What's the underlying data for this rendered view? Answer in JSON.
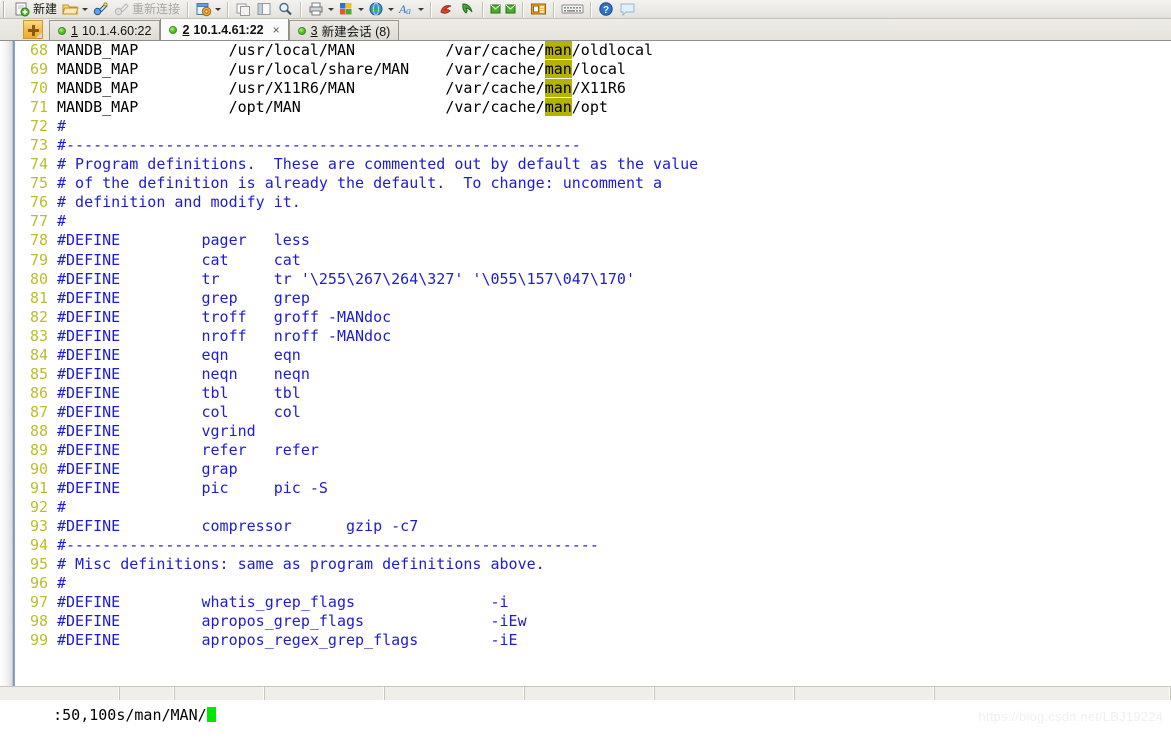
{
  "toolbar": {
    "new_label": "新建",
    "reconnect_label": "重新连接",
    "items": [
      {
        "name": "new-session-icon",
        "type": "icon"
      },
      {
        "name": "new-session-label",
        "type": "label"
      },
      {
        "name": "open-folder-icon",
        "type": "icon"
      },
      {
        "name": "open-folder-dropdown-arrow",
        "type": "arrow"
      },
      {
        "name": "connect-icon",
        "type": "icon"
      },
      {
        "name": "disconnect-icon",
        "type": "icon"
      },
      {
        "name": "reconnect-label",
        "type": "label-dim"
      },
      {
        "name": "session-options-icon",
        "type": "icon"
      },
      {
        "name": "session-options-dropdown-arrow",
        "type": "arrow"
      },
      {
        "name": "clone-session-icon",
        "type": "icon"
      },
      {
        "name": "tile-windows-icon",
        "type": "icon"
      },
      {
        "name": "find-icon",
        "type": "icon"
      },
      {
        "name": "print-icon",
        "type": "icon"
      },
      {
        "name": "print-dropdown-arrow",
        "type": "arrow"
      },
      {
        "name": "color-scheme-icon",
        "type": "icon"
      },
      {
        "name": "color-scheme-dropdown-arrow",
        "type": "arrow"
      },
      {
        "name": "globe-icon",
        "type": "icon"
      },
      {
        "name": "globe-dropdown-arrow",
        "type": "arrow"
      },
      {
        "name": "font-icon",
        "type": "icon"
      },
      {
        "name": "font-dropdown-arrow",
        "type": "arrow"
      },
      {
        "name": "upload-icon",
        "type": "icon"
      },
      {
        "name": "download-icon",
        "type": "icon"
      },
      {
        "name": "chat-green-icon",
        "type": "icon"
      },
      {
        "name": "chat-green2-icon",
        "type": "icon"
      },
      {
        "name": "window-log-icon",
        "type": "icon"
      },
      {
        "name": "keyboard-icon",
        "type": "icon"
      },
      {
        "name": "help-icon",
        "type": "icon"
      },
      {
        "name": "feedback-icon",
        "type": "icon"
      }
    ]
  },
  "tabs": {
    "new_tab_button": "+",
    "items": [
      {
        "num": "1",
        "title": "10.1.4.60:22",
        "active": false,
        "closable": false
      },
      {
        "num": "2",
        "title": "10.1.4.61:22",
        "active": true,
        "closable": true,
        "close_glyph": "×"
      },
      {
        "num": "3",
        "title": "新建会话 (8)",
        "active": false,
        "closable": false
      }
    ]
  },
  "terminal": {
    "lines": [
      {
        "num": "68",
        "segments": [
          {
            "text": "MANDB_MAP",
            "color": "black"
          },
          {
            "text": "          /usr/local/MAN",
            "color": "black"
          },
          {
            "text": "          /var/cache/",
            "color": "black"
          },
          {
            "text": "man",
            "color": "black",
            "highlight": true
          },
          {
            "text": "/oldlocal",
            "color": "black"
          }
        ]
      },
      {
        "num": "69",
        "segments": [
          {
            "text": "MANDB_MAP",
            "color": "black"
          },
          {
            "text": "          /usr/local/share/MAN",
            "color": "black"
          },
          {
            "text": "    /var/cache/",
            "color": "black"
          },
          {
            "text": "man",
            "color": "black",
            "highlight": true
          },
          {
            "text": "/local",
            "color": "black"
          }
        ]
      },
      {
        "num": "70",
        "segments": [
          {
            "text": "MANDB_MAP",
            "color": "black"
          },
          {
            "text": "          /usr/X11R6/MAN",
            "color": "black"
          },
          {
            "text": "          /var/cache/",
            "color": "black"
          },
          {
            "text": "man",
            "color": "black",
            "highlight": true
          },
          {
            "text": "/X11R6",
            "color": "black"
          }
        ]
      },
      {
        "num": "71",
        "segments": [
          {
            "text": "MANDB_MAP",
            "color": "black"
          },
          {
            "text": "          /opt/MAN",
            "color": "black"
          },
          {
            "text": "                /var/cache/",
            "color": "black"
          },
          {
            "text": "man",
            "color": "black",
            "highlight": true
          },
          {
            "text": "/opt",
            "color": "black"
          }
        ]
      },
      {
        "num": "72",
        "segments": [
          {
            "text": "#",
            "color": "blue"
          }
        ]
      },
      {
        "num": "73",
        "segments": [
          {
            "text": "#---------------------------------------------------------",
            "color": "blue"
          }
        ]
      },
      {
        "num": "74",
        "segments": [
          {
            "text": "# Program definitions.  These are commented out by default as the value",
            "color": "blue"
          }
        ]
      },
      {
        "num": "75",
        "segments": [
          {
            "text": "# of the definition is already the default.  To change: uncomment a",
            "color": "blue"
          }
        ]
      },
      {
        "num": "76",
        "segments": [
          {
            "text": "# definition and modify it.",
            "color": "blue"
          }
        ]
      },
      {
        "num": "77",
        "segments": [
          {
            "text": "#",
            "color": "blue"
          }
        ]
      },
      {
        "num": "78",
        "segments": [
          {
            "text": "#DEFINE         pager   less",
            "color": "blue"
          }
        ]
      },
      {
        "num": "79",
        "segments": [
          {
            "text": "#DEFINE         cat     cat",
            "color": "blue"
          }
        ]
      },
      {
        "num": "80",
        "segments": [
          {
            "text": "#DEFINE         tr      tr '\\255\\267\\264\\327' '\\055\\157\\047\\170'",
            "color": "blue"
          }
        ]
      },
      {
        "num": "81",
        "segments": [
          {
            "text": "#DEFINE         grep    grep",
            "color": "blue"
          }
        ]
      },
      {
        "num": "82",
        "segments": [
          {
            "text": "#DEFINE         troff   groff -MANdoc",
            "color": "blue"
          }
        ]
      },
      {
        "num": "83",
        "segments": [
          {
            "text": "#DEFINE         nroff   nroff -MANdoc",
            "color": "blue"
          }
        ]
      },
      {
        "num": "84",
        "segments": [
          {
            "text": "#DEFINE         eqn     eqn",
            "color": "blue"
          }
        ]
      },
      {
        "num": "85",
        "segments": [
          {
            "text": "#DEFINE         neqn    neqn",
            "color": "blue"
          }
        ]
      },
      {
        "num": "86",
        "segments": [
          {
            "text": "#DEFINE         tbl     tbl",
            "color": "blue"
          }
        ]
      },
      {
        "num": "87",
        "segments": [
          {
            "text": "#DEFINE         col     col",
            "color": "blue"
          }
        ]
      },
      {
        "num": "88",
        "segments": [
          {
            "text": "#DEFINE         vgrind",
            "color": "blue"
          }
        ]
      },
      {
        "num": "89",
        "segments": [
          {
            "text": "#DEFINE         refer   refer",
            "color": "blue"
          }
        ]
      },
      {
        "num": "90",
        "segments": [
          {
            "text": "#DEFINE         grap",
            "color": "blue"
          }
        ]
      },
      {
        "num": "91",
        "segments": [
          {
            "text": "#DEFINE         pic     pic -S",
            "color": "blue"
          }
        ]
      },
      {
        "num": "92",
        "segments": [
          {
            "text": "#",
            "color": "blue"
          }
        ]
      },
      {
        "num": "93",
        "segments": [
          {
            "text": "#DEFINE         compressor      gzip -c7",
            "color": "blue"
          }
        ]
      },
      {
        "num": "94",
        "segments": [
          {
            "text": "#-----------------------------------------------------------",
            "color": "blue"
          }
        ]
      },
      {
        "num": "95",
        "segments": [
          {
            "text": "# Misc definitions: same as program definitions above.",
            "color": "blue"
          }
        ]
      },
      {
        "num": "96",
        "segments": [
          {
            "text": "#",
            "color": "blue"
          }
        ]
      },
      {
        "num": "97",
        "segments": [
          {
            "text": "#DEFINE         whatis_grep_flags               -i",
            "color": "blue"
          }
        ]
      },
      {
        "num": "98",
        "segments": [
          {
            "text": "#DEFINE         apropos_grep_flags              -iEw",
            "color": "blue"
          }
        ]
      },
      {
        "num": "99",
        "segments": [
          {
            "text": "#DEFINE         apropos_regex_grep_flags        -iE",
            "color": "blue"
          }
        ]
      }
    ],
    "command_line": ":50,100s/man/MAN/",
    "cursor": "block"
  },
  "watermark": "https://blog.csdn.net/LBJ19224",
  "statusbar": {
    "cells": [
      "",
      "",
      "",
      "",
      "",
      "",
      "",
      "",
      ""
    ]
  },
  "colors": {
    "line_number": "#bdbd2a",
    "comment": "#1c1cd6",
    "highlight_bg": "#b3b300",
    "cursor": "#00e800",
    "tab_active_bg": "#fbfbfa"
  }
}
